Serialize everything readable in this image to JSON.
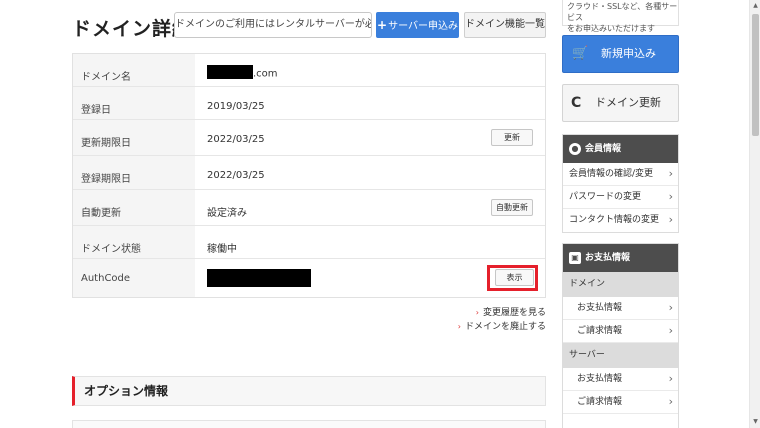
{
  "header": {
    "title": "ドメイン詳細",
    "notice": "ドメインのご利用にはレンタルサーバーが必要です",
    "server_apply": "サーバー申込み",
    "server_apply_plus": "+",
    "domain_functions": "ドメイン機能一覧"
  },
  "details": {
    "rows": [
      {
        "label": "ドメイン名",
        "value_suffix": ".com"
      },
      {
        "label": "登録日",
        "value": "2019/03/25"
      },
      {
        "label": "更新期限日",
        "value": "2022/03/25",
        "button": "更新"
      },
      {
        "label": "登録期限日",
        "value": "2022/03/25"
      },
      {
        "label": "自動更新",
        "value": "設定済み",
        "button": "自動更新"
      },
      {
        "label": "ドメイン状態",
        "value": "稼働中"
      },
      {
        "label": "AuthCode",
        "button": "表示"
      }
    ]
  },
  "links": {
    "history": "変更履歴を見る",
    "abolish": "ドメインを廃止する",
    "arrow": "›"
  },
  "options": {
    "title": "オプション情報"
  },
  "sidebar": {
    "top_note_line1": "クラウド・SSLなど、各種サービス",
    "top_note_line2": "をお申込みいただけます",
    "new_apply": "新規申込み",
    "domain_renew": "ドメイン更新",
    "member": {
      "title": "会員情報",
      "items": [
        "会員情報の確認/変更",
        "パスワードの変更",
        "コンタクト情報の変更"
      ]
    },
    "payment": {
      "title": "お支払情報",
      "group_domain": "ドメイン",
      "domain_items": [
        "お支払情報",
        "ご請求情報"
      ],
      "group_server": "サーバー",
      "server_items": [
        "お支払情報",
        "ご請求情報"
      ]
    }
  },
  "icons": {
    "cart": "🛒",
    "renew": "C",
    "chevron": "›",
    "person": "●",
    "wallet": "▣"
  },
  "colors": {
    "accent": "#3a7fdc",
    "highlight": "#e5202b",
    "panel_head": "#4d4d4d"
  }
}
